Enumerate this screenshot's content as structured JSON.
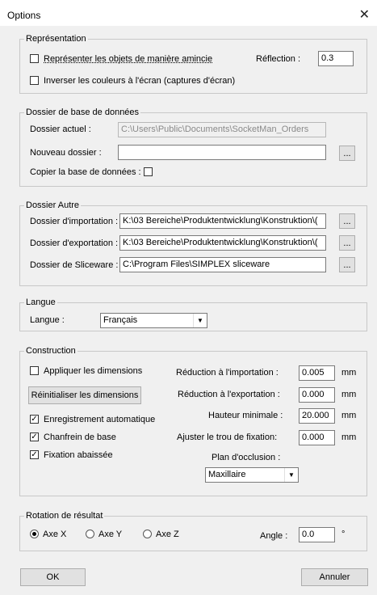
{
  "window": {
    "title": "Options",
    "close": "✕"
  },
  "representation": {
    "legend": "Représentation",
    "thin_label": "Représenter les objets de manière amincie",
    "thin_checked": false,
    "invert_label": "Inverser les couleurs à l'écran (captures d'écran)",
    "invert_checked": false,
    "reflection_label": "Réflection :",
    "reflection_value": "0.3"
  },
  "database": {
    "legend": "Dossier de base de données",
    "current_label": "Dossier actuel :",
    "current_value": "C:\\Users\\Public\\Documents\\SocketMan_Orders",
    "new_label": "Nouveau dossier :",
    "new_value": "",
    "browse": "...",
    "copy_label": "Copier la base de données :",
    "copy_checked": false
  },
  "other": {
    "legend": "Dossier Autre",
    "import_label": "Dossier d'importation :",
    "import_value": "K:\\03 Bereiche\\Produktentwicklung\\Konstruktion\\(",
    "export_label": "Dossier d'exportation :",
    "export_value": "K:\\03 Bereiche\\Produktentwicklung\\Konstruktion\\(",
    "slice_label": "Dossier de Sliceware :",
    "slice_value": "C:\\Program Files\\SIMPLEX sliceware",
    "browse": "..."
  },
  "language": {
    "legend": "Langue",
    "label": "Langue :",
    "value": "Français"
  },
  "construction": {
    "legend": "Construction",
    "apply_dims_label": "Appliquer les dimensions",
    "apply_dims_checked": false,
    "reset_dims_button": "Réinitialiser les dimensions",
    "autosave_label": "Enregistrement automatique",
    "autosave_checked": true,
    "chamfer_label": "Chanfrein de base",
    "chamfer_checked": true,
    "lowered_label": "Fixation abaissée",
    "lowered_checked": true,
    "import_reduction_label": "Réduction à l'importation :",
    "import_reduction_value": "0.005",
    "export_reduction_label": "Réduction à l'exportation :",
    "export_reduction_value": "0.000",
    "min_height_label": "Hauteur minimale :",
    "min_height_value": "20.000",
    "fix_hole_label": "Ajuster le trou de fixation:",
    "fix_hole_value": "0.000",
    "unit": "mm",
    "occlusion_label": "Plan d'occlusion :",
    "occlusion_value": "Maxillaire"
  },
  "rotation": {
    "legend": "Rotation de résultat",
    "axis_x": "Axe X",
    "axis_y": "Axe Y",
    "axis_z": "Axe Z",
    "selected": "Axe X",
    "angle_label": "Angle :",
    "angle_value": "0.0",
    "angle_unit": "°"
  },
  "footer": {
    "ok": "OK",
    "cancel": "Annuler"
  }
}
